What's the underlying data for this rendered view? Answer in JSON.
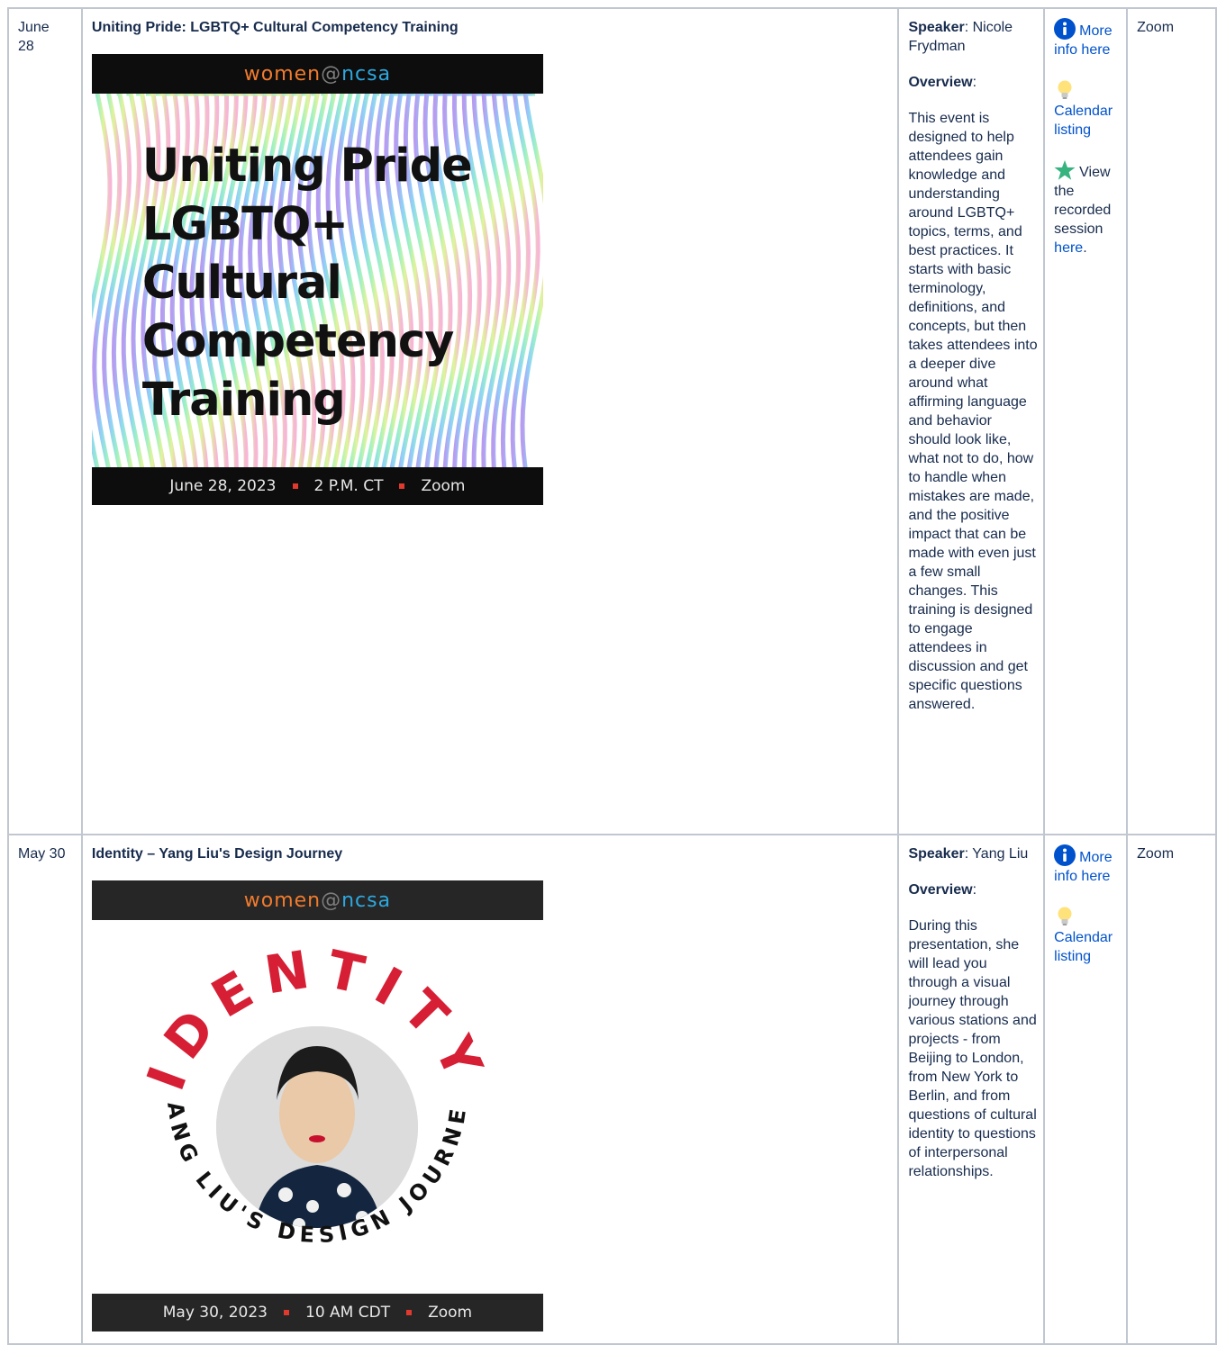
{
  "rows": [
    {
      "date": "June 28",
      "title": "Uniting Pride: LGBTQ+ Cultural Competency Training",
      "poster": {
        "brand_women": "women",
        "brand_at": "@",
        "brand_ncsa": "ncsa",
        "headline_lines": [
          "Uniting Pride",
          "LGBTQ+",
          "Cultural",
          "Competency",
          "Training"
        ],
        "footer_date": "June 28, 2023",
        "footer_time": "2 P.M. CT",
        "footer_place": "Zoom"
      },
      "speaker_label": "Speaker",
      "speaker_name": ": Nicole Frydman",
      "overview_label": "Overview",
      "overview_colon": ":",
      "overview_text": "This event is designed to help attendees gain knowledge and understanding around LGBTQ+ topics, terms, and best practices. It starts with basic terminology, definitions, and concepts, but then takes attendees into a deeper dive around what affirming language and behavior should look like, what not to do, how to handle when mistakes are made, and the positive impact that can be made with even just a few small changes. This training is designed to engage attendees in discussion and get specific questions answered.",
      "links": {
        "more_info": "More info here",
        "calendar": "Calendar listing",
        "recorded_prefix": "View the recorded session",
        "recorded_link": "here",
        "recorded_suffix": "."
      },
      "location": "Zoom"
    },
    {
      "date": "May 30",
      "title": "Identity – Yang Liu's Design Journey",
      "poster": {
        "brand_women": "women",
        "brand_at": "@",
        "brand_ncsa": "ncsa",
        "arc_top": "IDENTITY",
        "arc_bottom": "YANG LIU'S DESIGN JOURNEY",
        "footer_date": "May 30, 2023",
        "footer_time": "10 AM CDT",
        "footer_place": "Zoom"
      },
      "speaker_label": "Speaker",
      "speaker_name": ": Yang Liu",
      "overview_label": "Overview",
      "overview_colon": ":",
      "overview_text": "During this presentation, she will lead you through a visual journey through various stations and projects - from Beijing to London, from New York to Berlin, and from questions of cultural identity to questions of interpersonal relationships.",
      "links": {
        "more_info": "More info here",
        "calendar": "Calendar listing"
      },
      "location": "Zoom"
    }
  ],
  "icons": {
    "info": "info-icon",
    "idea": "lightbulb-icon",
    "star": "star-icon"
  },
  "colors": {
    "link": "#0052cc",
    "border": "#c1c7d0",
    "text": "#172b4d"
  }
}
